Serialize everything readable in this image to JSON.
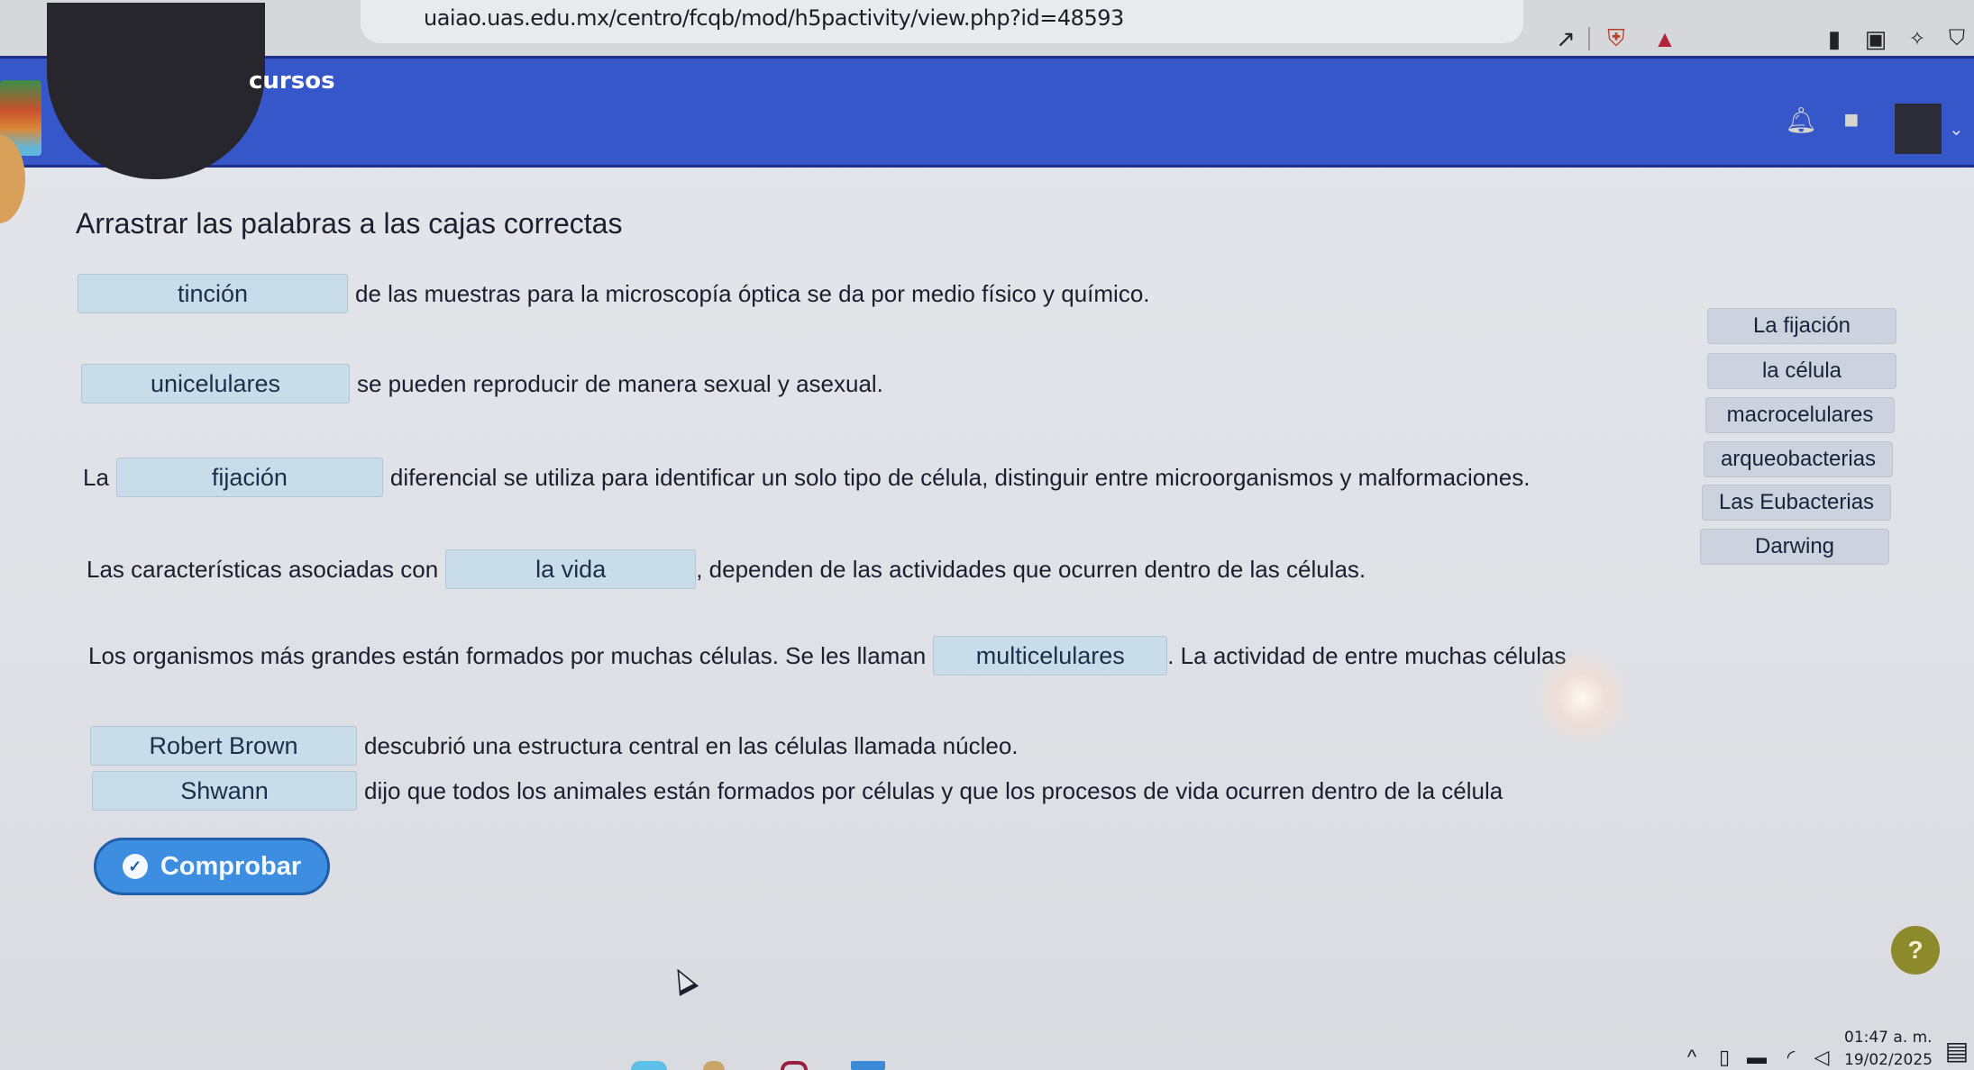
{
  "browser": {
    "url": "uaiao.uas.edu.mx/centro/fcqb/mod/h5pactivity/view.php?id=48593",
    "icons": [
      "share-icon",
      "brave-shield-icon",
      "brave-rewards-icon",
      "sidebar-icon",
      "wallet-icon",
      "leo-ai-icon",
      "vpn-icon"
    ]
  },
  "header": {
    "nav_link": "cursos",
    "icons": [
      "bell-icon",
      "chat-icon"
    ],
    "avatar_caret": "⌄"
  },
  "activity": {
    "title": "Arrastrar las palabras a las cajas correctas",
    "sentences": [
      {
        "before": "",
        "answer": "tinción",
        "after": "de las muestras para la microscopía óptica se da por medio físico y químico."
      },
      {
        "before": "",
        "answer": "unicelulares",
        "after": "se pueden reproducir de manera sexual y asexual."
      },
      {
        "before": "La",
        "answer": "fijación",
        "after": "diferencial se utiliza para identificar un solo tipo de célula, distinguir entre microorganismos y malformaciones."
      },
      {
        "before": "Las características asociadas con",
        "answer": "la vida",
        "after": ", dependen de las actividades que ocurren dentro de las células."
      },
      {
        "before": "Los organismos más grandes están formados por muchas células. Se les llaman",
        "answer": "multicelulares",
        "after": ". La actividad de entre muchas células"
      },
      {
        "before": "",
        "answer": "Robert Brown",
        "after": "descubrió una estructura central en las células llamada núcleo."
      },
      {
        "before": "",
        "answer": "Shwann",
        "after": "dijo que todos los animales están formados por células y que los procesos de vida ocurren dentro de la célula"
      }
    ],
    "word_bank": [
      "La fijación",
      "la célula",
      "macrocelulares",
      "arqueobacterias",
      "Las Eubacterias",
      "Darwing"
    ],
    "check_button": "Comprobar",
    "help_button": "?"
  },
  "taskbar": {
    "time": "01:47 a. m.",
    "date": "19/02/2025",
    "tray_icons": [
      "chevron-up-icon",
      "meet-now-icon",
      "battery-icon",
      "wifi-icon",
      "volume-icon"
    ]
  },
  "colors": {
    "header_bg": "#3557c9",
    "drop_box_bg": "#c9dcea",
    "word_chip_bg": "#ccd3de",
    "check_button_bg": "#3d8ee0",
    "help_button_bg": "#8c8a2a"
  }
}
